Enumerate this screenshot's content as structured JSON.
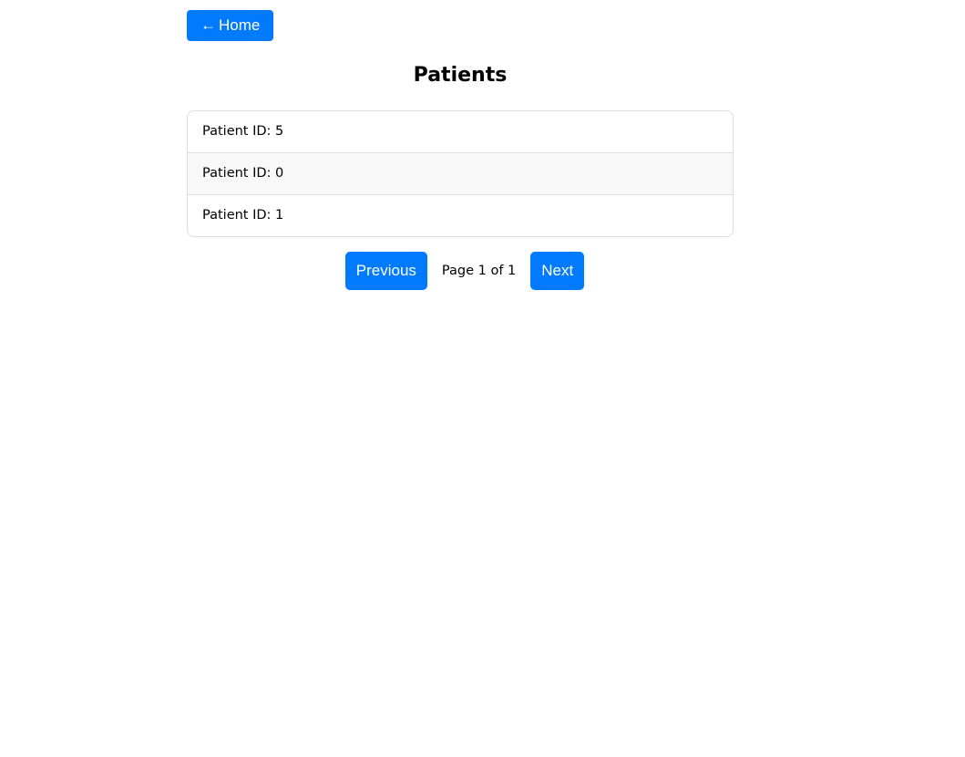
{
  "nav": {
    "home_arrow": "←",
    "home_label": "Home"
  },
  "page": {
    "title": "Patients"
  },
  "patients": [
    {
      "label": "Patient ID: 5"
    },
    {
      "label": "Patient ID: 0"
    },
    {
      "label": "Patient ID: 1"
    }
  ],
  "pagination": {
    "previous_label": "Previous",
    "page_info": "Page 1 of 1",
    "next_label": "Next"
  },
  "colors": {
    "accent": "#007bff",
    "row_alt": "#f8f8f8",
    "border": "#dddddd"
  }
}
